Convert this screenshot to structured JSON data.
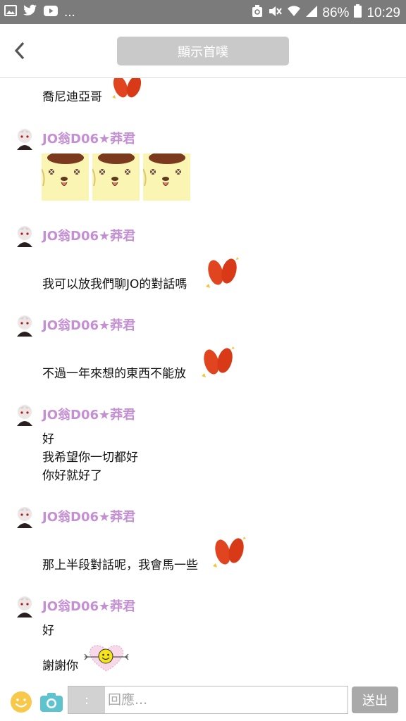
{
  "status_bar": {
    "notification_icons": [
      "gallery-icon",
      "twitter-icon",
      "youtube-icon"
    ],
    "more": "...",
    "battery": "86%",
    "time": "10:29"
  },
  "header": {
    "title": "顯示首噗"
  },
  "messages": [
    {
      "lines": [
        "喬尼迪亞哥"
      ],
      "emoji": "red-bean-icon"
    },
    {
      "username": "JO翁D06★莽君",
      "stickers": [
        "pompompurin-sticker",
        "pompompurin-sticker",
        "pompompurin-sticker"
      ]
    },
    {
      "username": "JO翁D06★莽君",
      "lines": [
        "我可以放我們聊JO的對話嗎"
      ],
      "emoji": "red-bean-icon"
    },
    {
      "username": "JO翁D06★莽君",
      "lines": [
        "不過一年來想的東西不能放"
      ],
      "emoji": "red-bean-icon"
    },
    {
      "username": "JO翁D06★莽君",
      "lines": [
        "好",
        "我希望你一切都好",
        "你好就好了"
      ]
    },
    {
      "username": "JO翁D06★莽君",
      "lines": [
        "那上半段對話呢，我會馬一些"
      ],
      "emoji": "red-bean-icon"
    },
    {
      "username": "JO翁D06★莽君",
      "lines": [
        "好",
        "謝謝你"
      ],
      "emoji": "smiley-heart-icon"
    }
  ],
  "composer": {
    "colon": ":",
    "placeholder": "回應...",
    "send_label": "送出"
  },
  "colors": {
    "username": "#c48fd3",
    "status_bar": "#7b7b7b",
    "pill": "#c9c9c9",
    "send": "#a9a9a9"
  }
}
